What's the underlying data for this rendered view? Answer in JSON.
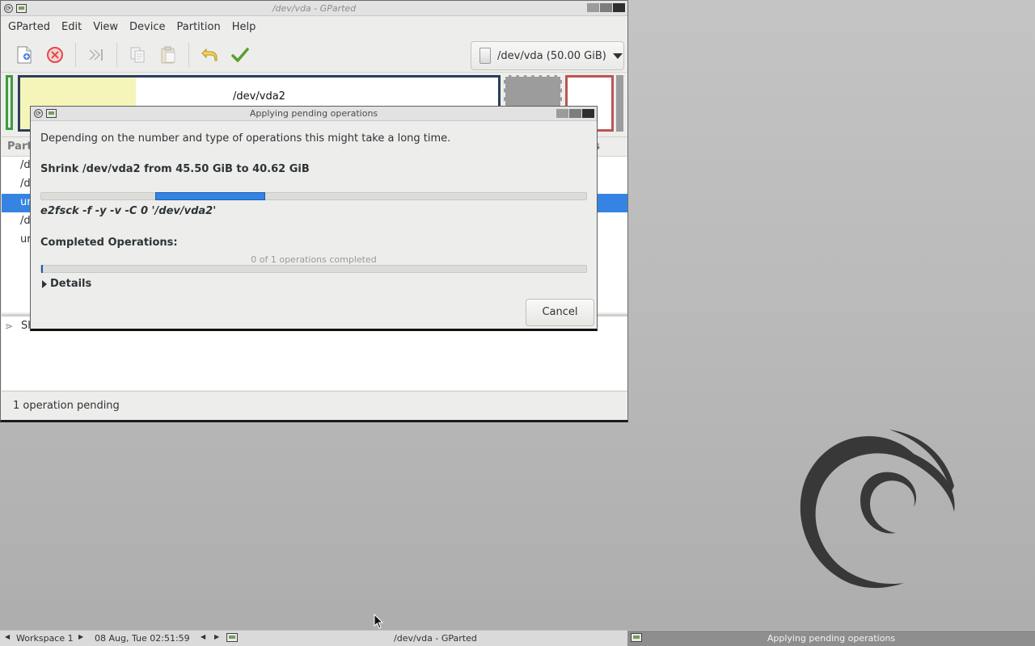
{
  "desktop": {
    "logo_icon": "debian-swirl-icon"
  },
  "main_window": {
    "title": "/dev/vda - GParted",
    "menu": [
      "GParted",
      "Edit",
      "View",
      "Device",
      "Partition",
      "Help"
    ],
    "toolbar": {
      "tools": [
        "new-icon",
        "delete-icon",
        "resize-move-icon",
        "copy-icon",
        "paste-icon",
        "undo-icon",
        "apply-icon"
      ],
      "device": "/dev/vda (50.00 GiB)"
    },
    "disk_map": {
      "selected_label": "/dev/vda2"
    },
    "partition_list": {
      "header_left": "Part",
      "header_right": "s",
      "rows": [
        "/d",
        "/d",
        "ur",
        "/d",
        "ur"
      ]
    },
    "operations_pane": {
      "row_label": "Sh"
    },
    "status": "1 operation pending"
  },
  "dialog": {
    "title": "Applying pending operations",
    "intro": "Depending on the number and type of operations this might take a long time.",
    "current_operation": "Shrink /dev/vda2 from 45.50 GiB to 40.62 GiB",
    "command": "e2fsck -f -y -v -C 0 '/dev/vda2'",
    "completed_heading": "Completed Operations:",
    "completed_count": "0 of 1 operations completed",
    "completed_fraction": 0.0,
    "details_label": "Details",
    "cancel_label": "Cancel"
  },
  "taskbar": {
    "workspace": "Workspace 1",
    "clock": "08 Aug, Tue 02:51:59",
    "tasks": [
      "/dev/vda - GParted",
      "Applying pending operations"
    ]
  },
  "colors": {
    "selection": "#3584e4",
    "progress": "#3584e4",
    "apply_green": "#5aa02c",
    "undo_yellow": "#e5b82a",
    "delete_red": "#e04b4b"
  }
}
